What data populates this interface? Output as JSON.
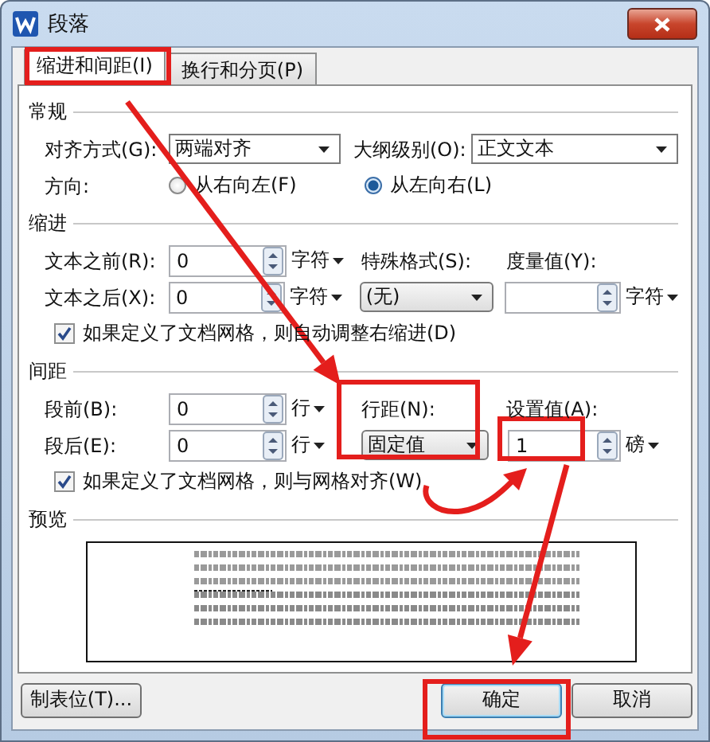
{
  "window": {
    "title": "段落"
  },
  "tabs": [
    {
      "label": "缩进和间距(I)",
      "selected": true
    },
    {
      "label": "换行和分页(P)",
      "selected": false
    }
  ],
  "general": {
    "heading": "常规",
    "alignment": {
      "label": "对齐方式(G):",
      "value": "两端对齐"
    },
    "outline_level": {
      "label": "大纲级别(O):",
      "value": "正文文本"
    },
    "direction": {
      "label": "方向:",
      "options": [
        {
          "label": "从右向左(F)",
          "selected": false
        },
        {
          "label": "从左向右(L)",
          "selected": true
        }
      ]
    }
  },
  "indent": {
    "heading": "缩进",
    "before": {
      "label": "文本之前(R):",
      "value": "0",
      "unit": "字符"
    },
    "after": {
      "label": "文本之后(X):",
      "value": "0",
      "unit": "字符"
    },
    "special": {
      "label": "特殊格式(S):",
      "value": "(无)"
    },
    "measure": {
      "label": "度量值(Y):",
      "unit": "字符"
    },
    "auto_adjust": {
      "label": "如果定义了文档网格，则自动调整右缩进(D)",
      "checked": true
    }
  },
  "spacing": {
    "heading": "间距",
    "before": {
      "label": "段前(B):",
      "value": "0",
      "unit": "行"
    },
    "after": {
      "label": "段后(E):",
      "value": "0",
      "unit": "行"
    },
    "line_spacing": {
      "label": "行距(N):",
      "value": "固定值"
    },
    "setting": {
      "label": "设置值(A):",
      "value": "1",
      "unit": "磅"
    },
    "snap_to_grid": {
      "label": "如果定义了文档网格，则与网格对齐(W)",
      "checked": true
    }
  },
  "preview": {
    "heading": "预览"
  },
  "buttons": [
    {
      "label": "制表位(T)...",
      "default": false
    },
    {
      "label": "确定",
      "default": true
    },
    {
      "label": "取消",
      "default": false
    }
  ],
  "annotations": [
    {
      "kind": "box"
    },
    {
      "kind": "arrow"
    },
    {
      "kind": "box"
    },
    {
      "kind": "box"
    },
    {
      "kind": "squiggle"
    },
    {
      "kind": "arrow"
    },
    {
      "kind": "box"
    }
  ]
}
